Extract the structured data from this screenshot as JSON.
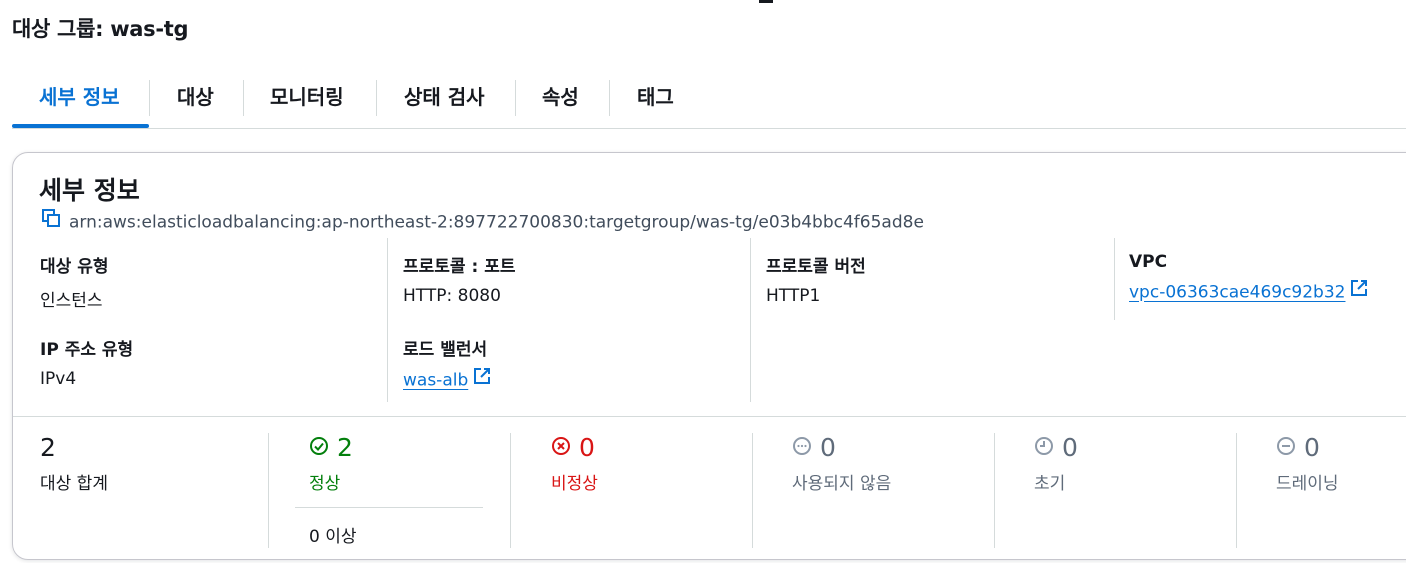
{
  "page": {
    "title": "대상 그룹: was-tg"
  },
  "tabs": [
    {
      "label": "세부 정보",
      "active": true
    },
    {
      "label": "대상"
    },
    {
      "label": "모니터링"
    },
    {
      "label": "상태 검사"
    },
    {
      "label": "속성"
    },
    {
      "label": "태그"
    }
  ],
  "details": {
    "title": "세부 정보",
    "arn": "arn:aws:elasticloadbalancing:ap-northeast-2:897722700830:targetgroup/was-tg/e03b4bbc4f65ad8e",
    "fields": {
      "target_type": {
        "label": "대상 유형",
        "value": "인스턴스"
      },
      "protocol_port": {
        "label": "프로토콜 : 포트",
        "value": "HTTP: 8080"
      },
      "protocol_version": {
        "label": "프로토콜 버전",
        "value": "HTTP1"
      },
      "vpc": {
        "label": "VPC",
        "value": "vpc-06363cae469c92b32"
      },
      "ip_address_type": {
        "label": "IP 주소 유형",
        "value": "IPv4"
      },
      "load_balancer": {
        "label": "로드 밸런서",
        "value": "was-alb"
      }
    }
  },
  "stats": {
    "total": {
      "value": "2",
      "label": "대상 합계"
    },
    "healthy": {
      "value": "2",
      "label": "정상",
      "sub": "0 이상",
      "icon": "check-circle-icon"
    },
    "unhealthy": {
      "value": "0",
      "label": "비정상",
      "icon": "x-circle-icon"
    },
    "unused": {
      "value": "0",
      "label": "사용되지 않음",
      "icon": "ellipsis-circle-icon"
    },
    "initial": {
      "value": "0",
      "label": "초기",
      "icon": "clock-icon"
    },
    "draining": {
      "value": "0",
      "label": "드레이닝",
      "icon": "minus-circle-icon"
    }
  },
  "colors": {
    "accent": "#0972d3",
    "success": "#037f0c",
    "error": "#d91515",
    "muted": "#5f6b7a",
    "border": "#d5dbdb"
  }
}
